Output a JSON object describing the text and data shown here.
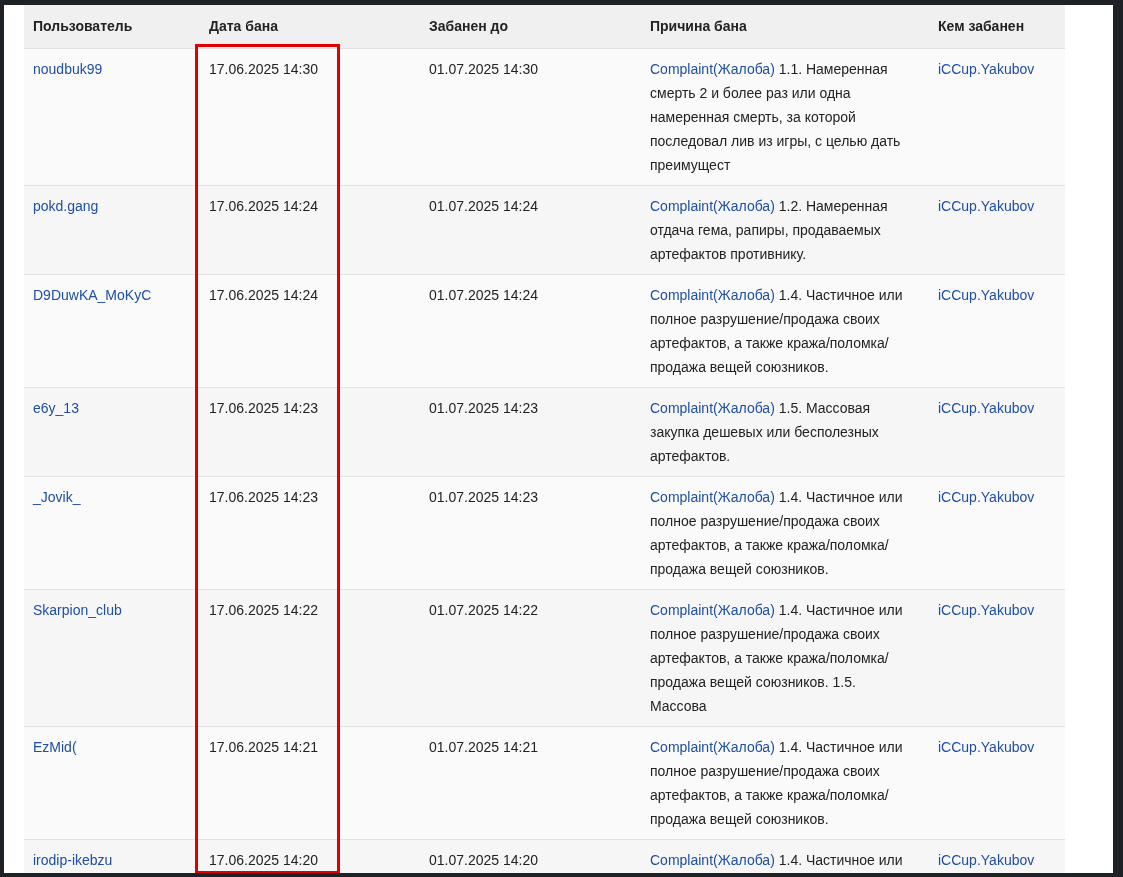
{
  "table": {
    "columns": [
      {
        "label": "Пользователь",
        "highlighted": false
      },
      {
        "label": "Дата бана",
        "highlighted": true
      },
      {
        "label": "Забанен до",
        "highlighted": false
      },
      {
        "label": "Причина бана",
        "highlighted": false
      },
      {
        "label": "Кем забанен",
        "highlighted": false
      }
    ],
    "rows": [
      {
        "user": "noudbuk99",
        "banned_on": "17.06.2025 14:30",
        "banned_until": "01.07.2025 14:30",
        "reason_link": "Complaint(Жалоба)",
        "reason_text": "1.1. Намеренная смерть 2 и более раз или одна намеренная смерть, за которой последовал лив из игры, с целью дать преимущест",
        "banned_by": "iCCup.Yakubov"
      },
      {
        "user": "pokd.gang",
        "banned_on": "17.06.2025 14:24",
        "banned_until": "01.07.2025 14:24",
        "reason_link": "Complaint(Жалоба)",
        "reason_text": "1.2. Намеренная отдача гема, рапиры, продаваемых артефактов противнику.",
        "banned_by": "iCCup.Yakubov"
      },
      {
        "user": "D9DuwKA_MoKyC",
        "banned_on": "17.06.2025 14:24",
        "banned_until": "01.07.2025 14:24",
        "reason_link": "Complaint(Жалоба)",
        "reason_text": "1.4. Частичное или полное разрушение/продажа своих артефактов, а также кража/поломка/продажа вещей союзников.",
        "banned_by": "iCCup.Yakubov"
      },
      {
        "user": "e6y_13",
        "banned_on": "17.06.2025 14:23",
        "banned_until": "01.07.2025 14:23",
        "reason_link": "Complaint(Жалоба)",
        "reason_text": "1.5. Массовая закупка дешевых или бесполезных артефактов.",
        "banned_by": "iCCup.Yakubov"
      },
      {
        "user": "_Jovik_",
        "banned_on": "17.06.2025 14:23",
        "banned_until": "01.07.2025 14:23",
        "reason_link": "Complaint(Жалоба)",
        "reason_text": "1.4. Частичное или полное разрушение/продажа своих артефактов, а также кража/поломка/продажа вещей союзников.",
        "banned_by": "iCCup.Yakubov"
      },
      {
        "user": "Skarpion_club",
        "banned_on": "17.06.2025 14:22",
        "banned_until": "01.07.2025 14:22",
        "reason_link": "Complaint(Жалоба)",
        "reason_text": "1.4. Частичное или полное разрушение/продажа своих артефактов, а также кража/поломка/продажа вещей союзников. 1.5. Массова",
        "banned_by": "iCCup.Yakubov"
      },
      {
        "user": "EzMid(",
        "banned_on": "17.06.2025 14:21",
        "banned_until": "01.07.2025 14:21",
        "reason_link": "Complaint(Жалоба)",
        "reason_text": "1.4. Частичное или полное разрушение/продажа своих артефактов, а также кража/поломка/продажа вещей союзников.",
        "banned_by": "iCCup.Yakubov"
      },
      {
        "user": "irodip-ikebzu",
        "banned_on": "17.06.2025 14:20",
        "banned_until": "01.07.2025 14:20",
        "reason_link": "Complaint(Жалоба)",
        "reason_text": "1.4. Частичное или",
        "banned_by": "iCCup.Yakubov"
      }
    ]
  }
}
